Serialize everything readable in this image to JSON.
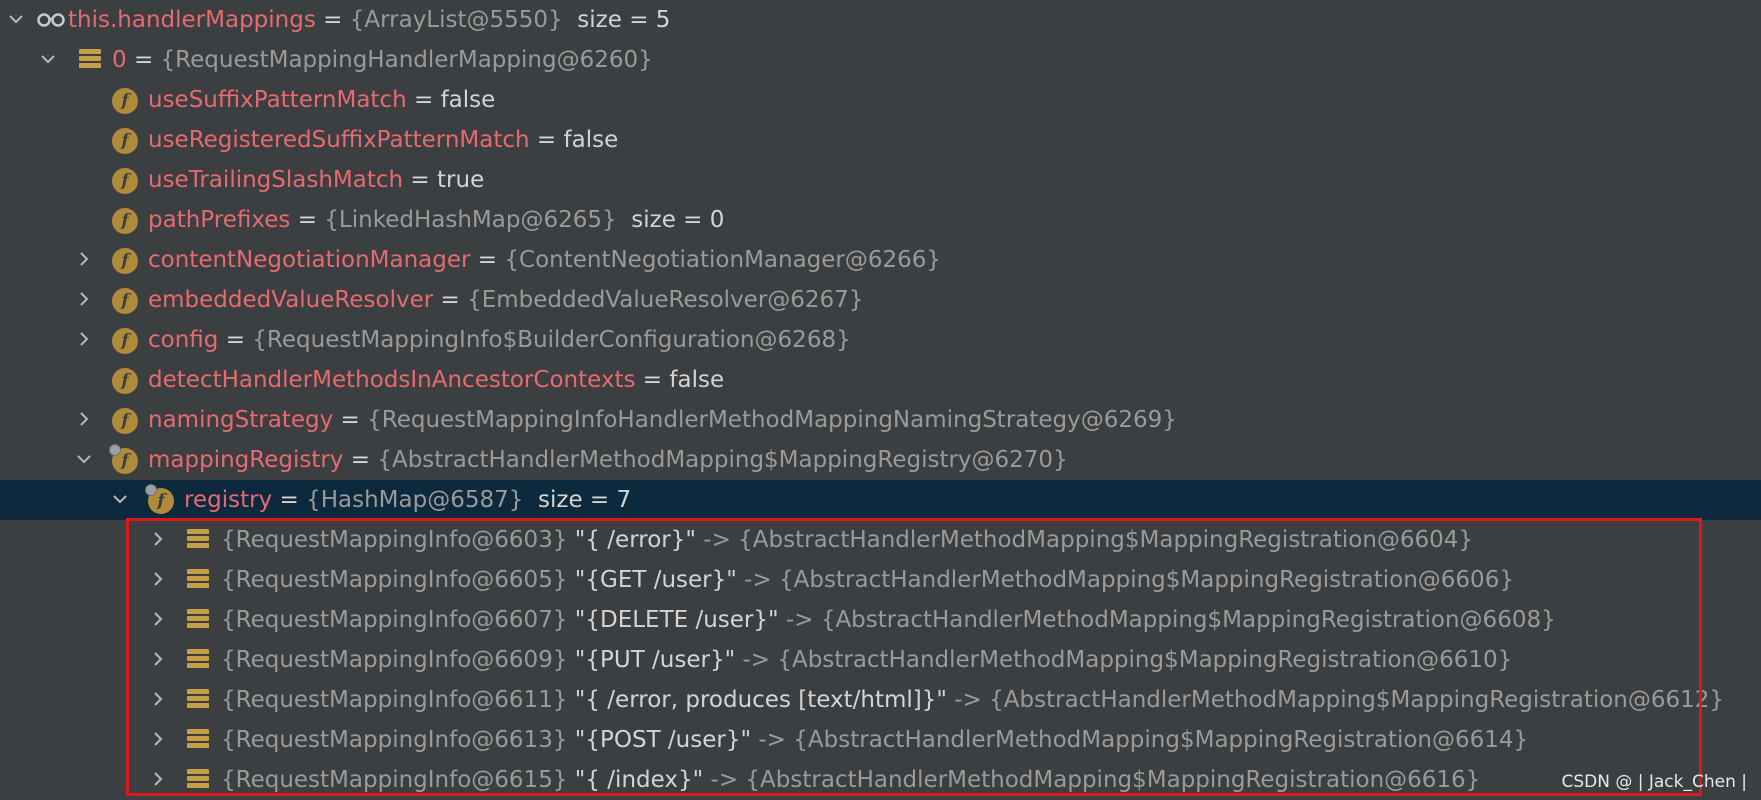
{
  "colors": {
    "background": "#3c3f41",
    "selected_row": "#0d293e",
    "field_name": "#e66a6f",
    "reference": "#9a9a9a",
    "highlight_box": "#e0161e",
    "field_icon": "#b08c3a"
  },
  "root": {
    "name": "this.handlerMappings",
    "op": "=",
    "ref": "{ArrayList@5550}",
    "extra": "size = 5",
    "icon": "glasses-icon"
  },
  "item0": {
    "name": "0",
    "op": "=",
    "ref": "{RequestMappingHandlerMapping@6260}",
    "icon": "stack-icon"
  },
  "fields": {
    "useSuffixPatternMatch": {
      "name": "useSuffixPatternMatch",
      "op": "=",
      "value": "false"
    },
    "useRegisteredSuffixPatternMatch": {
      "name": "useRegisteredSuffixPatternMatch",
      "op": "=",
      "value": "false"
    },
    "useTrailingSlashMatch": {
      "name": "useTrailingSlashMatch",
      "op": "=",
      "value": "true"
    },
    "pathPrefixes": {
      "name": "pathPrefixes",
      "op": "=",
      "ref": "{LinkedHashMap@6265}",
      "extra": "size = 0"
    },
    "contentNegotiationManager": {
      "name": "contentNegotiationManager",
      "op": "=",
      "ref": "{ContentNegotiationManager@6266}"
    },
    "embeddedValueResolver": {
      "name": "embeddedValueResolver",
      "op": "=",
      "ref": "{EmbeddedValueResolver@6267}"
    },
    "config": {
      "name": "config",
      "op": "=",
      "ref": "{RequestMappingInfo$BuilderConfiguration@6268}"
    },
    "detectHandlerMethodsInAncestorContexts": {
      "name": "detectHandlerMethodsInAncestorContexts",
      "op": "=",
      "value": "false"
    },
    "namingStrategy": {
      "name": "namingStrategy",
      "op": "=",
      "ref": "{RequestMappingInfoHandlerMethodMappingNamingStrategy@6269}"
    },
    "mappingRegistry": {
      "name": "mappingRegistry",
      "op": "=",
      "ref": "{AbstractHandlerMethodMapping$MappingRegistry@6270}"
    },
    "registry": {
      "name": "registry",
      "op": "=",
      "ref": "{HashMap@6587}",
      "extra": "size = 7"
    }
  },
  "registry_entries": [
    {
      "key": "{RequestMappingInfo@6603}",
      "str": "\"{ /error}\"",
      "arrow": "->",
      "value": "{AbstractHandlerMethodMapping$MappingRegistration@6604}"
    },
    {
      "key": "{RequestMappingInfo@6605}",
      "str": "\"{GET /user}\"",
      "arrow": "->",
      "value": "{AbstractHandlerMethodMapping$MappingRegistration@6606}"
    },
    {
      "key": "{RequestMappingInfo@6607}",
      "str": "\"{DELETE /user}\"",
      "arrow": "->",
      "value": "{AbstractHandlerMethodMapping$MappingRegistration@6608}"
    },
    {
      "key": "{RequestMappingInfo@6609}",
      "str": "\"{PUT /user}\"",
      "arrow": "->",
      "value": "{AbstractHandlerMethodMapping$MappingRegistration@6610}"
    },
    {
      "key": "{RequestMappingInfo@6611}",
      "str": "\"{ /error, produces [text/html]}\"",
      "arrow": "->",
      "value": "{AbstractHandlerMethodMapping$MappingRegistration@6612}"
    },
    {
      "key": "{RequestMappingInfo@6613}",
      "str": "\"{POST /user}\"",
      "arrow": "->",
      "value": "{AbstractHandlerMethodMapping$MappingRegistration@6614}"
    },
    {
      "key": "{RequestMappingInfo@6615}",
      "str": "\"{ /index}\"",
      "arrow": "->",
      "value": "{AbstractHandlerMethodMapping$MappingRegistration@6616}"
    }
  ],
  "watermark": "CSDN @ | Jack_Chen |"
}
